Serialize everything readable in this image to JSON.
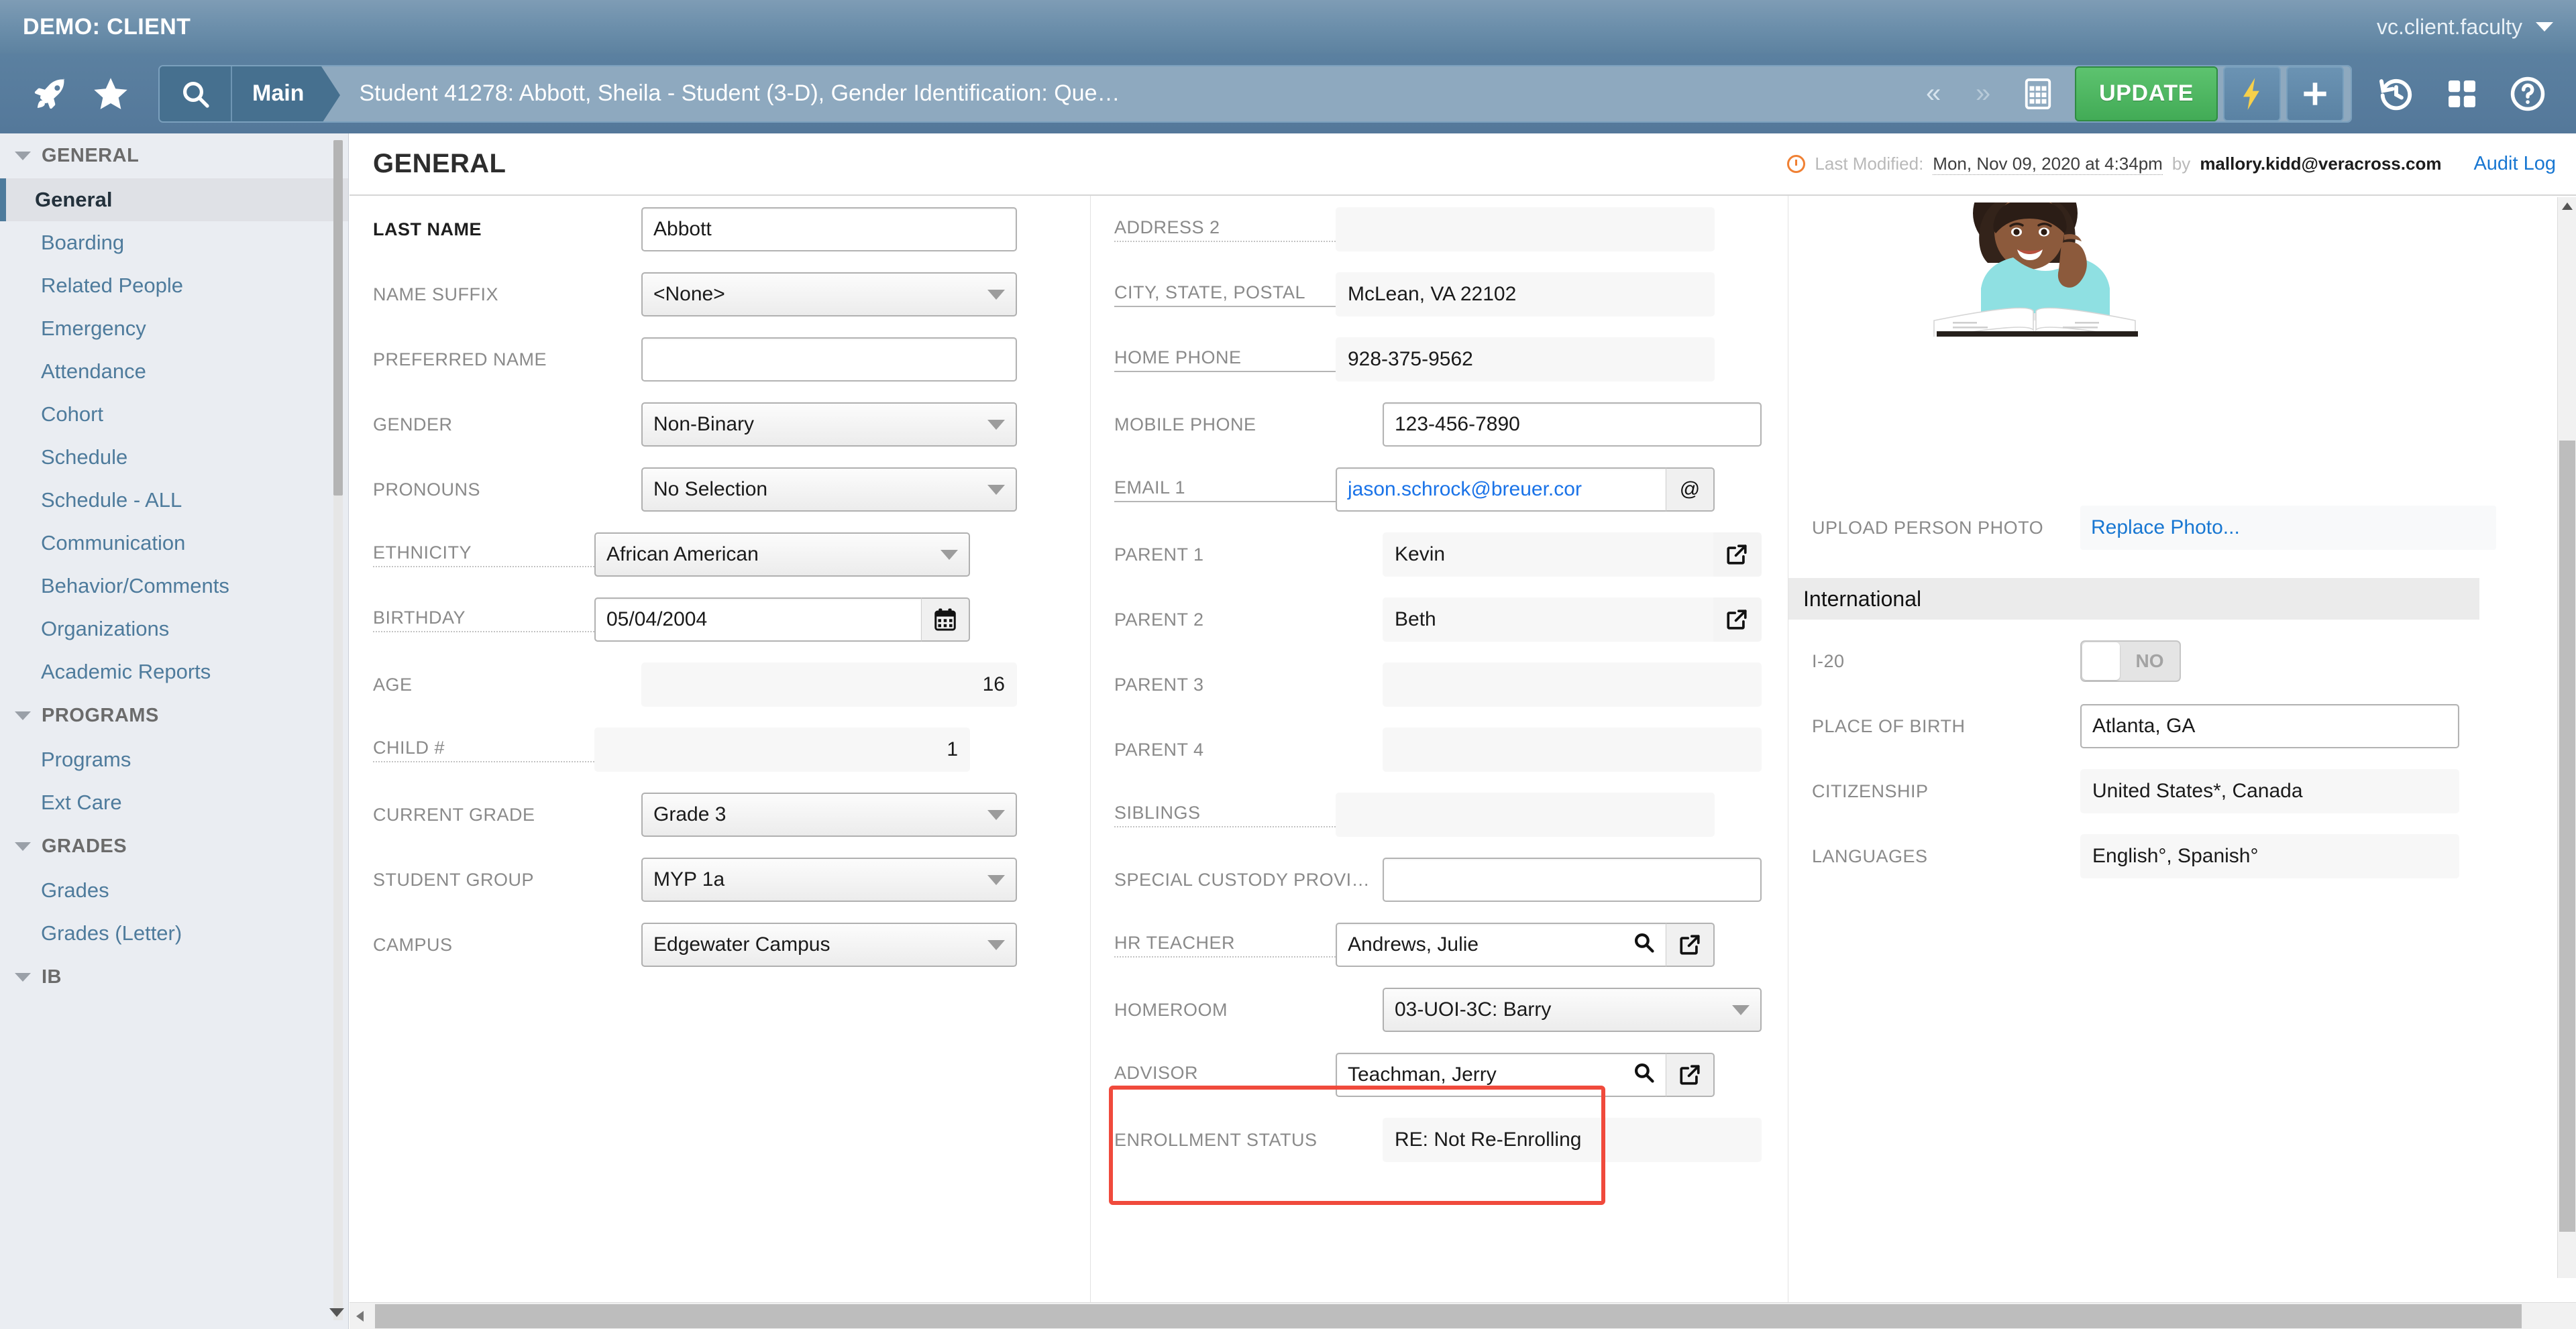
{
  "topbar": {
    "brand": "DEMO: CLIENT",
    "user": "vc.client.faculty"
  },
  "navbar": {
    "main_tab": "Main",
    "record_title": "Student 41278: Abbott, Sheila - Student (3-D), Gender Identification: Que…",
    "prev_label": "«",
    "next_label": "»",
    "update_label": "UPDATE"
  },
  "sidebar": {
    "groups": [
      {
        "label": "GENERAL",
        "items": [
          "General",
          "Boarding",
          "Related People",
          "Emergency",
          "Attendance",
          "Cohort",
          "Schedule",
          "Schedule - ALL",
          "Communication",
          "Behavior/Comments",
          "Organizations",
          "Academic Reports"
        ]
      },
      {
        "label": "PROGRAMS",
        "items": [
          "Programs",
          "Ext Care"
        ]
      },
      {
        "label": "GRADES",
        "items": [
          "Grades",
          "Grades (Letter)"
        ]
      },
      {
        "label": "IB",
        "items": []
      }
    ],
    "active_item": "General"
  },
  "content": {
    "page_title": "GENERAL",
    "last_modified_label": "Last Modified:",
    "last_modified_date": "Mon, Nov 09, 2020 at 4:34pm",
    "last_modified_by_label": "by",
    "last_modified_user": "mallory.kidd@veracross.com",
    "audit_log_label": "Audit Log"
  },
  "left_column": [
    {
      "label": "LAST NAME",
      "value": "Abbott",
      "type": "input",
      "bold": true
    },
    {
      "label": "NAME SUFFIX",
      "value": "<None>",
      "type": "select"
    },
    {
      "label": "PREFERRED NAME",
      "value": "",
      "type": "input"
    },
    {
      "label": "GENDER",
      "value": "Non-Binary",
      "type": "select"
    },
    {
      "label": "PRONOUNS",
      "value": "No Selection",
      "type": "select"
    },
    {
      "label": "ETHNICITY",
      "value": "African American",
      "type": "select",
      "underline": "dotted"
    },
    {
      "label": "BIRTHDAY",
      "value": "05/04/2004",
      "type": "date",
      "underline": "dotted"
    },
    {
      "label": "AGE",
      "value": "16",
      "type": "readonly-right"
    },
    {
      "label": "CHILD #",
      "value": "1",
      "type": "readonly-right",
      "underline": "dotted"
    },
    {
      "label": "CURRENT GRADE",
      "value": "Grade 3",
      "type": "select"
    },
    {
      "label": "STUDENT GROUP",
      "value": "MYP 1a",
      "type": "select"
    },
    {
      "label": "CAMPUS",
      "value": "Edgewater Campus",
      "type": "select"
    }
  ],
  "mid_column": [
    {
      "label": "ADDRESS 2",
      "value": "",
      "type": "readonly",
      "underline": "dotted"
    },
    {
      "label": "CITY, STATE, POSTAL",
      "value": "McLean, VA 22102",
      "type": "readonly",
      "underline": "solid"
    },
    {
      "label": "HOME PHONE",
      "value": "928-375-9562",
      "type": "readonly",
      "underline": "solid"
    },
    {
      "label": "MOBILE PHONE",
      "value": "123-456-7890",
      "type": "input"
    },
    {
      "label": "EMAIL 1",
      "value": "jason.schrock@breuer.cor",
      "type": "email",
      "addon": "@",
      "underline": "solid"
    },
    {
      "label": "PARENT 1",
      "value": "Kevin",
      "type": "readonly-link",
      "addon": "external-link"
    },
    {
      "label": "PARENT 2",
      "value": "Beth",
      "type": "readonly-link",
      "addon": "external-link"
    },
    {
      "label": "PARENT 3",
      "value": "",
      "type": "readonly"
    },
    {
      "label": "PARENT 4",
      "value": "",
      "type": "readonly"
    },
    {
      "label": "SIBLINGS",
      "value": "",
      "type": "readonly",
      "underline": "dotted"
    },
    {
      "label": "SPECIAL CUSTODY PROVI…",
      "value": "",
      "type": "input"
    },
    {
      "label": "HR TEACHER",
      "value": "Andrews, Julie",
      "type": "lookup",
      "underline": "dotted"
    },
    {
      "label": "HOMEROOM",
      "value": "03-UOI-3C: Barry",
      "type": "select"
    },
    {
      "label": "ADVISOR",
      "value": "Teachman, Jerry",
      "type": "lookup",
      "underline": "dotted"
    },
    {
      "label": "ENROLLMENT STATUS",
      "value": "RE: Not Re-Enrolling",
      "type": "readonly"
    }
  ],
  "right_column": {
    "upload_label": "UPLOAD PERSON PHOTO",
    "replace_photo_label": "Replace Photo...",
    "section_title": "International",
    "fields": [
      {
        "label": "I-20",
        "value": "NO",
        "type": "toggle"
      },
      {
        "label": "PLACE OF BIRTH",
        "value": "Atlanta, GA",
        "type": "input"
      },
      {
        "label": "CITIZENSHIP",
        "value": "United States*, Canada",
        "type": "readonly"
      },
      {
        "label": "LANGUAGES",
        "value": "English°, Spanish°",
        "type": "readonly"
      }
    ]
  },
  "colors": {
    "brand_blue": "#5d82a0",
    "accent_green": "#42ab56",
    "link_blue": "#1877d2",
    "highlight_red": "#f04a3c",
    "sidebar_bg": "#eaedf2"
  }
}
